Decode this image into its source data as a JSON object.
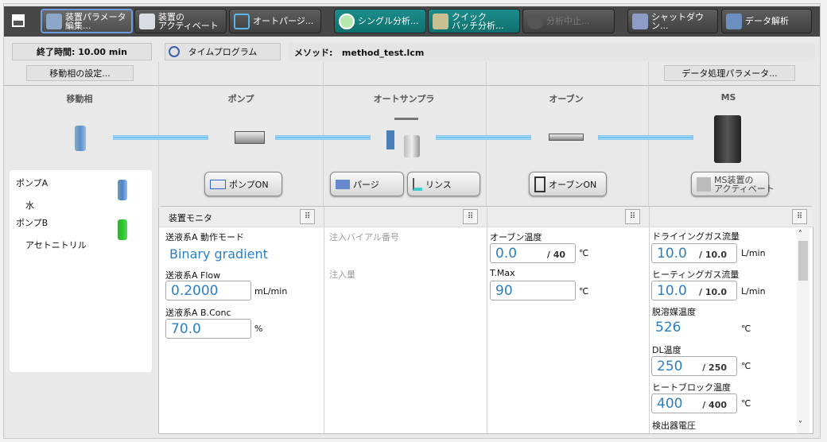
{
  "toolbar": {
    "buttons": [
      {
        "label": "装置パラメータ\n編集...",
        "icon": "parameter-edit-icon"
      },
      {
        "label": "装置の\nアクティベート",
        "icon": "instrument-icon"
      },
      {
        "label": "オートパージ...",
        "icon": "autopurge-icon"
      },
      {
        "label": "シングル分析...",
        "icon": "single-run-icon"
      },
      {
        "label": "クイック\nバッチ分析...",
        "icon": "batch-icon"
      },
      {
        "label": "分析中止...",
        "icon": "stop-icon"
      },
      {
        "label": "シャットダウン...",
        "icon": "shutdown-icon"
      },
      {
        "label": "データ解析",
        "icon": "data-analysis-icon"
      }
    ]
  },
  "info": {
    "end_time": "終了時間: 10.00 min",
    "time_program": "タイムプログラム",
    "method_label": "メソッド:",
    "method_file": "method_test.lcm",
    "mobile_phase_settings": "移動相の設定...",
    "data_processing": "データ処理パラメータ..."
  },
  "columns": [
    "移動相",
    "ポンプ",
    "オートサンプラ",
    "オーブン",
    "MS"
  ],
  "actions": {
    "pump_on": "ポンプON",
    "purge": "パージ",
    "rinse": "リンス",
    "oven_on": "オーブンON",
    "ms_activate": "MS装置の\nアクティベート"
  },
  "mobile_phase": {
    "pump_a": "ポンプA",
    "solvent_a": "水",
    "pump_b": "ポンプB",
    "solvent_b": "アセトニトリル"
  },
  "monitor": {
    "title": "装置モニタ",
    "pump": {
      "mode_label": "送液系A 動作モード",
      "mode_value": "Binary gradient",
      "flow_label": "送液系A Flow",
      "flow_value": "0.2000",
      "flow_unit": "mL/min",
      "conc_label": "送液系A B.Conc",
      "conc_value": "70.0",
      "conc_unit": "%"
    },
    "autosampler": {
      "vial_label": "注入バイアル番号",
      "volume_label": "注入量"
    },
    "oven": {
      "temp_label": "オーブン温度",
      "temp_value": "0.0",
      "temp_set": "/ 40",
      "temp_unit": "℃",
      "tmax_label": "T.Max",
      "tmax_value": "90",
      "tmax_unit": "℃"
    },
    "ms": {
      "dry_label": "ドライイングガス流量",
      "dry_value": "10.0",
      "dry_set": "/ 10.0",
      "dry_unit": "L/min",
      "heat_label": "ヒーティングガス流量",
      "heat_value": "10.0",
      "heat_set": "/ 10.0",
      "heat_unit": "L/min",
      "desolv_label": "脱溶媒温度",
      "desolv_value": "526",
      "desolv_unit": "℃",
      "dl_label": "DL温度",
      "dl_value": "250",
      "dl_set": "/ 250",
      "dl_unit": "℃",
      "hb_label": "ヒートブロック温度",
      "hb_value": "400",
      "hb_set": "/ 400",
      "hb_unit": "℃",
      "det_label": "検出器電圧"
    }
  }
}
